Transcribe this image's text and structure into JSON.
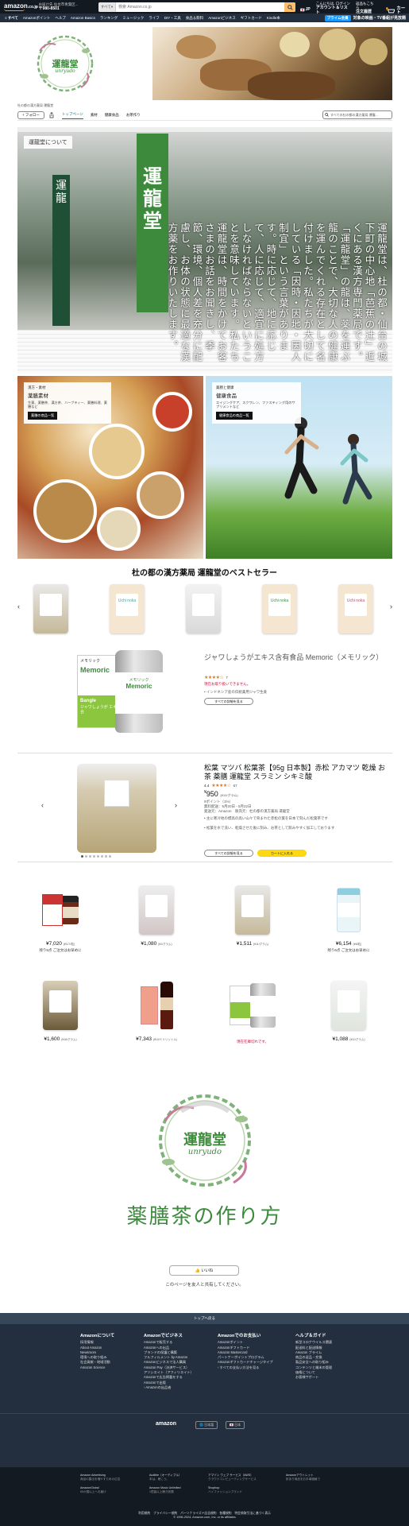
{
  "header": {
    "logo": "amazon",
    "logo_suffix": ".co.jp",
    "deliver_line1": "お届け先 仙台市青葉区...",
    "deliver_line2": "〒980-8501",
    "search_category": "すべて",
    "search_placeholder": "検索 Amazon.co.jp",
    "lang": "JP",
    "account_line1": "こんにちは, ログイン",
    "account_line2": "アカウント＆リスト",
    "orders_line1": "返品もこちら",
    "orders_line2": "注文履歴",
    "cart_count": "0",
    "cart_label": "カート"
  },
  "nav": {
    "items": [
      "≡ すべて",
      "Amazonポイント",
      "ヘルプ",
      "Amazon Basics",
      "ランキング",
      "ミュージック",
      "ライフ",
      "DIY・工具",
      "食品＆飲料",
      "Amazonビジネス",
      "ギフトカード",
      "Kindle本"
    ],
    "prime_pill": "プライム会員",
    "prime_text": "対象の映画・TV番組が見放題"
  },
  "store": {
    "logo_text": "運龍堂",
    "logo_sub": "unryudo",
    "byline": "杜の都の漢方薬局 運龍堂",
    "follow": "+ フォロー",
    "tabs": [
      "トップページ",
      "素材",
      "健康食品",
      "お茶作り"
    ],
    "search_placeholder": "すべての杜の都の漢方薬局 運龍..."
  },
  "about": {
    "tag": "運龍堂について",
    "sign_big": "運龍堂",
    "sign_left": "運龍",
    "text": "運龍堂は、杜の都・仙台の城下町の中心地「芭蕉の辻」近くにある漢方専門薬局です。「運龍堂」の龍は、薬を運ぶ龍のことで、大切な人の健康を運んでくれる存在として名付けました。私たちが大切にしている「因時・因地・因人制宜」という言葉があります。時に応じて、地に応じて、人に応じて、適宜に処方しなければならないということを意味しています。私たち運龍堂は、時間をかけてお客さまのお話をお聞きし、季節、環境、個人差を充分に配慮し、お体の状態に最適な漢方薬をお作りいたします。"
  },
  "tiles": [
    {
      "sub": "漢方・素材",
      "title": "薬膳素材",
      "desc": "生薬、薬膳茶、漢方茶、ハーブティー、薬膳料理、薬膳など",
      "button": "薬膳の商品一覧"
    },
    {
      "sub": "薬膳と健康",
      "title": "健康食品",
      "desc": "エイジングケア、スクワレン、ファスティング用のサプリメントなど",
      "button": "健康食品の商品一覧"
    }
  ],
  "bestsellers": {
    "title": "杜の都の漢方薬局 運龍堂のベストセラー",
    "items": [
      {
        "label": ""
      },
      {
        "label": "Uchi noka"
      },
      {
        "label": ""
      },
      {
        "label": "Uchi noka"
      },
      {
        "label": "Uchi noka"
      }
    ]
  },
  "feature1": {
    "title": "ジャワしょうがエキス含有食品 Memoric（メモリック）",
    "stars": "★★★★☆",
    "rating_count": "7",
    "stock": "現在お取り扱いできません。",
    "bullet": "• インドネシア産の伝統薬用ジャワ生姜",
    "button": "すべての詳細を見る",
    "box_brand": "メモリック",
    "box_name": "Memoric",
    "box_sub": "Bangle",
    "box_jp": "ジャワしょうが エキス配合"
  },
  "feature2": {
    "title": "松葉 マツバ 松葉茶【95g 日本製】赤松 アカマツ 乾燥 お茶 薬膳 運龍堂 スラミン シキミ酸",
    "rating": "4.4",
    "stars": "★★★★☆",
    "rating_count": "67",
    "price": "950",
    "unit_price": "(¥10/グラム)",
    "points": "9ポイント（1%）",
    "delivery": "無料配送：5月20日 - 5月22日",
    "ships": "発送元：Amazon　販売元：杜の都の漢方薬局 運龍堂",
    "bullet1": "• 主に寒冷地の標高の高い山々で育まれた赤松の葉を日本で刻んだ松葉茶です",
    "bullet2": "• 松葉を水で洗い、乾燥させた後に刻み、お茶として飲みやすく加工しております",
    "btn_details": "すべての詳細を見る",
    "btn_cart": "カートに入れる"
  },
  "grid": [
    {
      "price": "7,020",
      "unit": "(¥117/粒)",
      "note": "残り5点 ご注文はお早めに"
    },
    {
      "price": "1,080",
      "unit": "(¥1/グラム)",
      "note": ""
    },
    {
      "price": "1,511",
      "unit": "(¥11/グラム)",
      "note": ""
    },
    {
      "price": "6,154",
      "unit": "(¥6/粒)",
      "note": "残り6点 ご注文はお早めに"
    },
    {
      "price": "1,600",
      "unit": "(¥16/グラム)",
      "note": ""
    },
    {
      "price": "7,343",
      "unit": "(¥10/ミリリットル)",
      "note": ""
    },
    {
      "price": "",
      "unit": "",
      "note": "現在在庫切れです。"
    },
    {
      "price": "1,088",
      "unit": "(¥11/グラム)",
      "note": ""
    }
  ],
  "recipe": {
    "title": "薬膳茶の作り方",
    "like": "👍 いいね",
    "share": "このページを友人と共有してください。"
  },
  "footer": {
    "back_to_top": "トップへ戻る",
    "cols": [
      {
        "title": "Amazonについて",
        "items": [
          "採用情報",
          "About Amazon",
          "Newsroom",
          "環境への取り組み",
          "社会貢献・地域活動",
          "Amazon Science"
        ]
      },
      {
        "title": "Amazonでビジネス",
        "items": [
          "Amazonで販売する",
          "Amazonへの出品",
          "ブランドの保護と構築",
          "フルフィルメント by Amazon",
          "Amazonビジネスで法人購買",
          "Amazon Pay（決済サービス）",
          "アソシエイト（アフィリエイト）",
          "Amazonで広告掲載をする",
          "Amazonで出版",
          "› Amazonの出品者"
        ]
      },
      {
        "title": "Amazonでのお支払い",
        "items": [
          "Amazonポイント",
          "Amazonギフトカード",
          "Amazon Mastercard",
          "パートナーポイントプログラム",
          "Amazonギフトカードチャージタイプ",
          "› すべての支払い方法を見る"
        ]
      },
      {
        "title": "ヘルプ＆ガイド",
        "items": [
          "新型コロナウイルス関連",
          "配送料と配送情報",
          "Amazon プライム",
          "商品の返品・交換",
          "製品安全への取り組み",
          "コンテンツと端末の管理",
          "価格について",
          "お客様サポート"
        ]
      }
    ],
    "logo": "amazon",
    "lang": "🌐 日本語",
    "country": "🇯🇵 日本",
    "links": [
      {
        "title": "Amazon Advertising",
        "sub": "商品の露出を増やすための広告"
      },
      {
        "title": "AmazonGlobal",
        "sub": "65か国以上へお届け"
      },
      {
        "title": "Audible（オーディブル）",
        "sub": "本は、聴こう。"
      },
      {
        "title": "Amazon Music Unlimited",
        "sub": "1億曲以上聴き放題"
      },
      {
        "title": "Shopbop",
        "sub": "ハイファッションブランド"
      },
      {
        "title": "アマゾン ウェブ サービス（AWS）",
        "sub": "クラウドコンピューティングサービス"
      },
      {
        "title": "Amazonアウトレット",
        "sub": "訳あり商品をお手頃価格で"
      }
    ],
    "legal": "利用規約　プライバシー規約　パーソナライズド広告規約　各種規約　特定商取引法に基づく表示",
    "copyright": "© 1996-2024, Amazon.com, Inc. or its affiliates"
  },
  "colors": {
    "header": "#131921",
    "nav": "#232f3e",
    "accent": "#ff9900",
    "brand_green": "#3d8a3d",
    "link": "#007185"
  }
}
